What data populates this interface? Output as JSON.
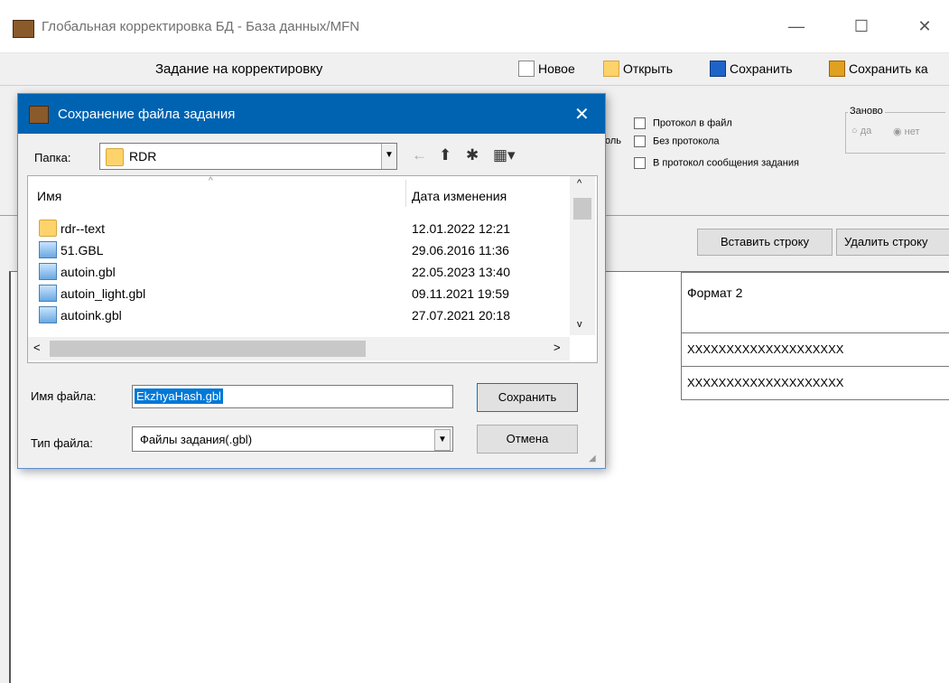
{
  "window": {
    "title": "Глобальная корректировка БД - База данных/MFN",
    "min_glyph": "—",
    "max_glyph": "☐",
    "close_glyph": "✕"
  },
  "toolbar": {
    "task_label": "Задание на корректировку",
    "new_label": "Новое",
    "open_label": "Открыть",
    "save_label": "Сохранить",
    "save_as_label": "Сохранить ка"
  },
  "options": {
    "protocol_file": "Протокол в файл",
    "no_protocol": "Без протокола",
    "protocol_messages": "В протокол сообщения задания",
    "cut_text": "оль",
    "anew_title": "Заново",
    "yes": "да",
    "no": "нет"
  },
  "actions": {
    "insert_row": "Вставить строку",
    "delete_row": "Удалить строку"
  },
  "grid": {
    "header": "Формат 2",
    "rows": [
      "XXXXXXXXXXXXXXXXXXXX",
      "XXXXXXXXXXXXXXXXXXXX"
    ]
  },
  "dialog": {
    "title": "Сохранение файла задания",
    "close_glyph": "✕",
    "folder_label": "Папка:",
    "folder_name": "RDR",
    "col_name": "Имя",
    "col_date": "Дата изменения",
    "files": [
      {
        "name": "rdr--text",
        "date": "12.01.2022 12:21",
        "kind": "folder"
      },
      {
        "name": "51.GBL",
        "date": "29.06.2016 11:36",
        "kind": "file"
      },
      {
        "name": "autoin.gbl",
        "date": "22.05.2023 13:40",
        "kind": "file"
      },
      {
        "name": "autoin_light.gbl",
        "date": "09.11.2021 19:59",
        "kind": "file"
      },
      {
        "name": "autoink.gbl",
        "date": "27.07.2021 20:18",
        "kind": "file"
      }
    ],
    "filename_label": "Имя файла:",
    "filename_value": "EkzhyaHash.gbl",
    "filetype_label": "Тип файла:",
    "filetype_value": "Файлы задания(.gbl)",
    "save_button": "Сохранить",
    "cancel_button": "Отмена"
  }
}
